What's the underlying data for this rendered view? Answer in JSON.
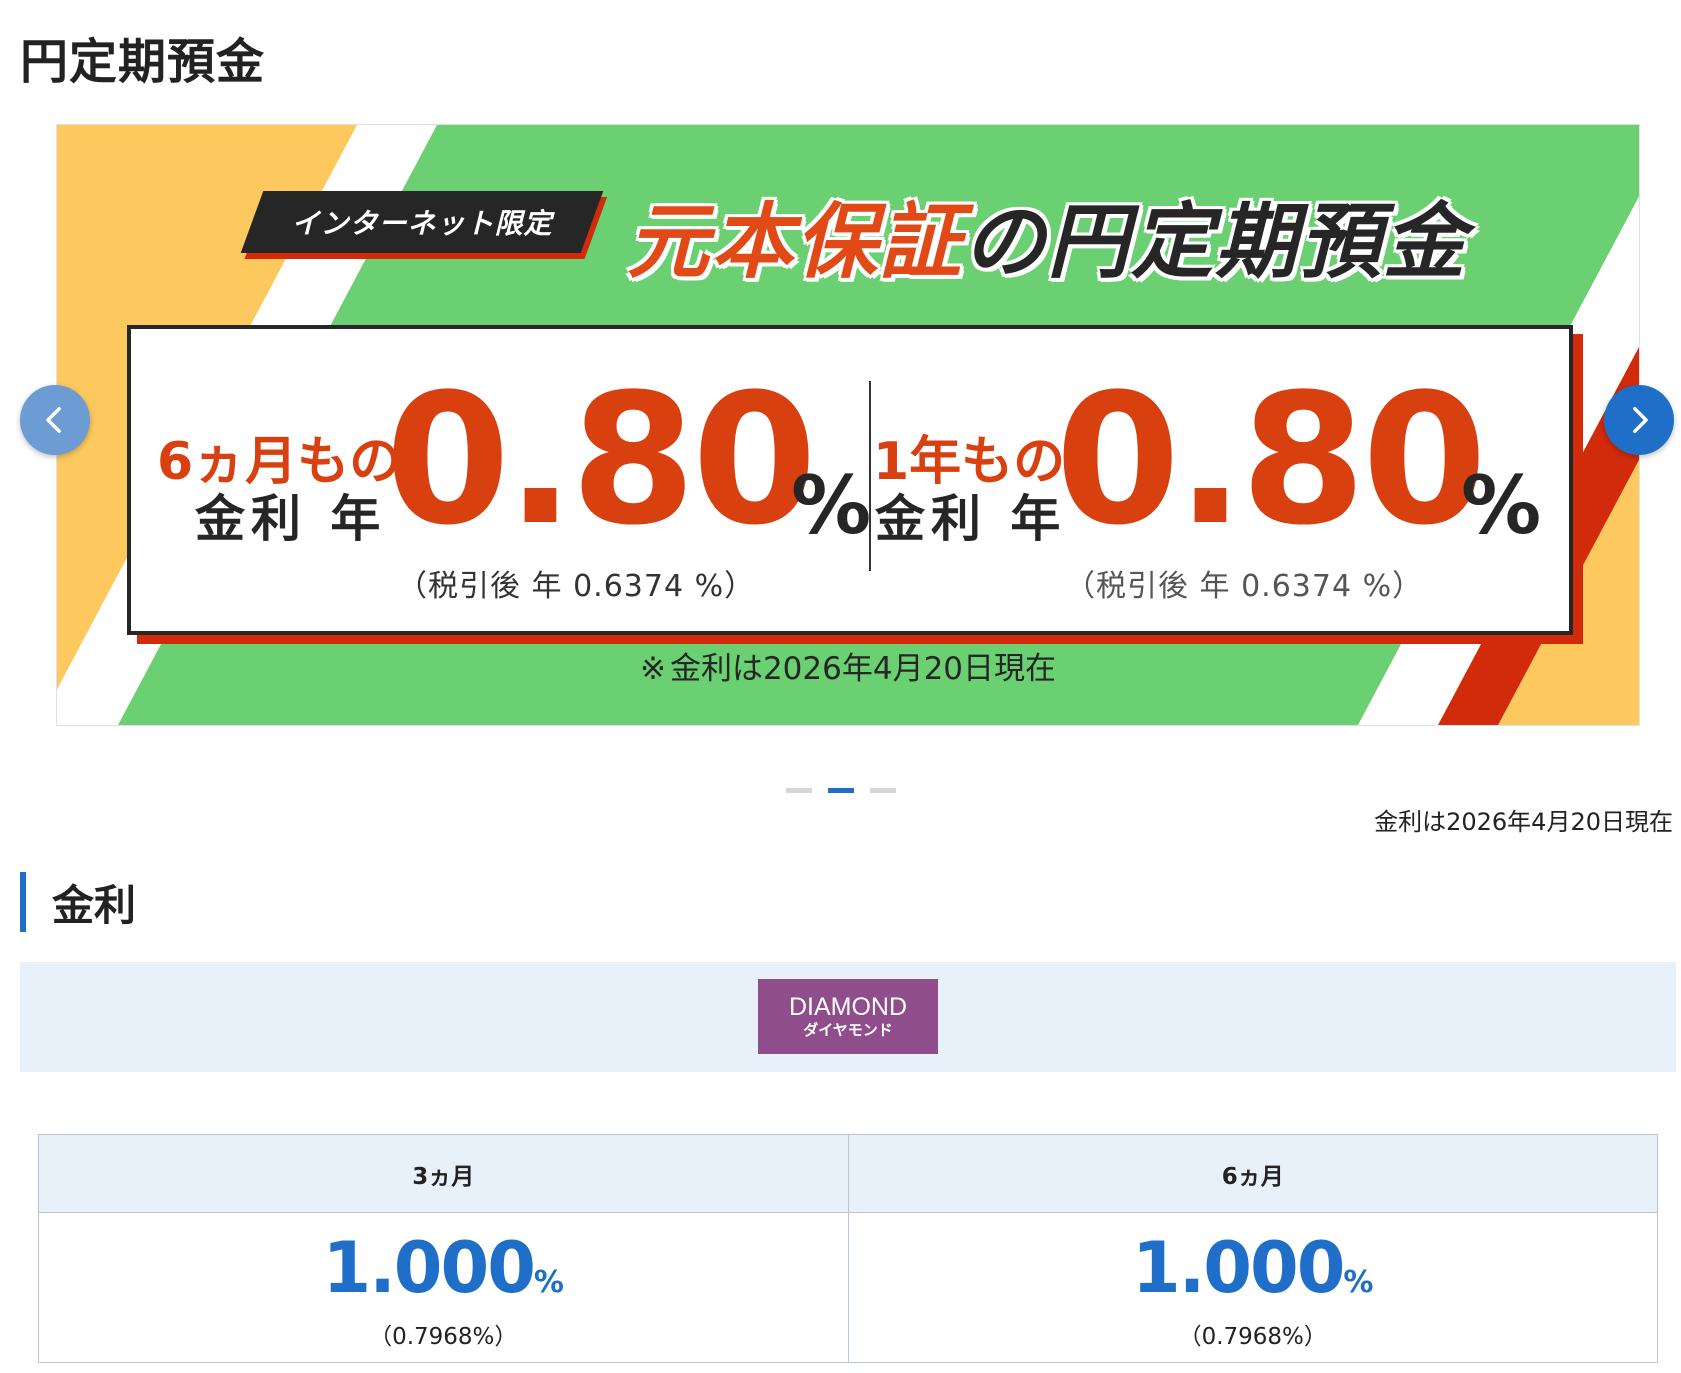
{
  "page": {
    "title": "円定期預金"
  },
  "banner": {
    "tag": "インターネット限定",
    "headline_red": "元本保証",
    "headline_dark": "の円定期預金",
    "colors": {
      "green": "#6bd072",
      "yellow": "#fdc95f",
      "red": "#d22b0c",
      "orange": "#d8400f",
      "dark": "#262626"
    },
    "offers": [
      {
        "term": "6ヵ月もの",
        "label": "金利 年",
        "rate": "0.80",
        "unit": "%",
        "after_tax": "（税引後 年 0.6374 %）"
      },
      {
        "term": "1年もの",
        "label": "金利 年",
        "rate": "0.80",
        "unit": "%",
        "after_tax": "（税引後 年 0.6374 %）"
      }
    ],
    "note_mark": "※",
    "note": "金利は2026年4月20日現在"
  },
  "carousel": {
    "prev_icon": "chevron-left-icon",
    "next_icon": "chevron-right-icon",
    "slides": 3,
    "active_slide": 2
  },
  "as_of": "金利は2026年4月20日現在",
  "section": {
    "title": "金利"
  },
  "plan": {
    "name_en": "DIAMOND",
    "name_ja": "ダイヤモンド",
    "color": "#8f4d8c"
  },
  "rate_table": {
    "headers": [
      "3ヵ月",
      "6ヵ月"
    ],
    "rows": [
      {
        "value": "1.000",
        "unit": "%",
        "after_tax": "（0.7968%）"
      },
      {
        "value": "1.000",
        "unit": "%",
        "after_tax": "（0.7968%）"
      }
    ]
  }
}
